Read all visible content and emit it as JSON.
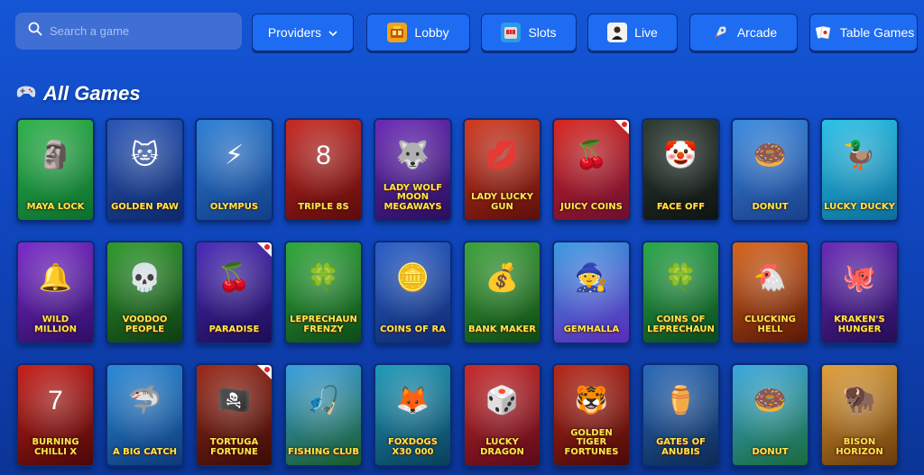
{
  "header": {
    "search": {
      "placeholder": "Search a game",
      "icon": "search-icon"
    },
    "nav": [
      {
        "id": "providers",
        "label": "Providers",
        "icon": "chevron-down-icon"
      },
      {
        "id": "lobby",
        "label": "Lobby",
        "icon": "lobby-icon"
      },
      {
        "id": "slots",
        "label": "Slots",
        "icon": "slot-machine-icon"
      },
      {
        "id": "live",
        "label": "Live",
        "icon": "live-dealer-icon"
      },
      {
        "id": "arcade",
        "label": "Arcade",
        "icon": "rocket-icon"
      },
      {
        "id": "table-games",
        "label": "Table Games",
        "icon": "cards-icon"
      }
    ]
  },
  "section": {
    "title": "All Games",
    "icon": "gamepad-icon"
  },
  "games": [
    {
      "name": "Maya Lock",
      "bg": [
        "#2fb24c",
        "#0c6e2e"
      ],
      "art": "🗿",
      "badge": false
    },
    {
      "name": "Golden Paw",
      "bg": [
        "#2a56b8",
        "#0e2a6b"
      ],
      "art": "🐱",
      "badge": false
    },
    {
      "name": "Olympus",
      "bg": [
        "#2c7fd6",
        "#123e87"
      ],
      "art": "⚡",
      "badge": false
    },
    {
      "name": "Triple 8s",
      "bg": [
        "#c82a24",
        "#5a0b0b"
      ],
      "art": "8",
      "badge": false
    },
    {
      "name": "Lady Wolf Moon Megaways",
      "bg": [
        "#6b2ab8",
        "#2a0f5c"
      ],
      "art": "🐺",
      "badge": false
    },
    {
      "name": "Lady Lucky Gun",
      "bg": [
        "#d23a22",
        "#5c0f0a"
      ],
      "art": "💋",
      "badge": false
    },
    {
      "name": "Juicy Coins",
      "bg": [
        "#d8261f",
        "#6a0f32"
      ],
      "art": "🍒",
      "badge": true
    },
    {
      "name": "Face Off",
      "bg": [
        "#2e3b33",
        "#0e1412"
      ],
      "art": "🤡",
      "badge": false
    },
    {
      "name": "Donut",
      "bg": [
        "#3a8ae0",
        "#1a3f8a"
      ],
      "art": "🍩",
      "badge": false
    },
    {
      "name": "Lucky Ducky",
      "bg": [
        "#29c1e6",
        "#0d6e9a"
      ],
      "art": "🦆",
      "badge": false
    },
    {
      "name": "Wild Million",
      "bg": [
        "#7a2ac9",
        "#2e0e66"
      ],
      "art": "🔔",
      "badge": false
    },
    {
      "name": "Voodoo People",
      "bg": [
        "#2f9a2c",
        "#0f3d14"
      ],
      "art": "💀",
      "badge": false
    },
    {
      "name": "Paradise",
      "bg": [
        "#4a2ab8",
        "#1d0e55"
      ],
      "art": "🍒",
      "badge": true
    },
    {
      "name": "Leprechaun Frenzy",
      "bg": [
        "#2fa93a",
        "#0e4a18"
      ],
      "art": "🍀",
      "badge": false
    },
    {
      "name": "Coins of Ra",
      "bg": [
        "#2a5fc9",
        "#0f2a70"
      ],
      "art": "🪙",
      "badge": false
    },
    {
      "name": "Bank Maker",
      "bg": [
        "#3da33a",
        "#0f4a14"
      ],
      "art": "💰",
      "badge": false
    },
    {
      "name": "Gemhalla",
      "bg": [
        "#3a9be0",
        "#5a2ab8"
      ],
      "art": "🧙",
      "badge": false
    },
    {
      "name": "Coins of Leprechaun",
      "bg": [
        "#2aa84a",
        "#0a4a1e"
      ],
      "art": "🍀",
      "badge": false
    },
    {
      "name": "Clucking Hell",
      "bg": [
        "#d8641a",
        "#5a1808"
      ],
      "art": "🐔",
      "badge": false
    },
    {
      "name": "Kraken's Hunger",
      "bg": [
        "#6a2ab8",
        "#240d55"
      ],
      "art": "🐙",
      "badge": false
    },
    {
      "name": "Burning Chilli X",
      "bg": [
        "#c81f1a",
        "#4a0808"
      ],
      "art": "7",
      "badge": false
    },
    {
      "name": "A Big Catch",
      "bg": [
        "#2a8ad6",
        "#0e3a7a"
      ],
      "art": "🦈",
      "badge": false
    },
    {
      "name": "Tortuga Fortune",
      "bg": [
        "#9a2a1a",
        "#3a0c08"
      ],
      "art": "🏴‍☠️",
      "badge": true
    },
    {
      "name": "Fishing Club",
      "bg": [
        "#3aa0e0",
        "#1a5a2a"
      ],
      "art": "🎣",
      "badge": false
    },
    {
      "name": "Foxdogs x30 000",
      "bg": [
        "#1f9ab8",
        "#0a3f5a"
      ],
      "art": "🦊",
      "badge": false
    },
    {
      "name": "Lucky Dragon",
      "bg": [
        "#c82a2a",
        "#5a0a1a"
      ],
      "art": "🎲",
      "badge": false
    },
    {
      "name": "Golden Tiger Fortunes",
      "bg": [
        "#b8281a",
        "#4a0a08"
      ],
      "art": "🐯",
      "badge": false
    },
    {
      "name": "Gates of Anubis",
      "bg": [
        "#2a6ab8",
        "#0e2a55"
      ],
      "art": "⚱️",
      "badge": false
    },
    {
      "name": "Donut",
      "bg": [
        "#3aa8e0",
        "#1a6a3a"
      ],
      "art": "🍩",
      "badge": false
    },
    {
      "name": "Bison Horizon",
      "bg": [
        "#e0a03a",
        "#6a3a0a"
      ],
      "art": "🦬",
      "badge": false
    }
  ],
  "colors": {
    "page_bg": "#1456d6",
    "nav_button": "#1d6cf2",
    "search_bg": "#3f6fd3",
    "game_title": "#ffe54a"
  }
}
